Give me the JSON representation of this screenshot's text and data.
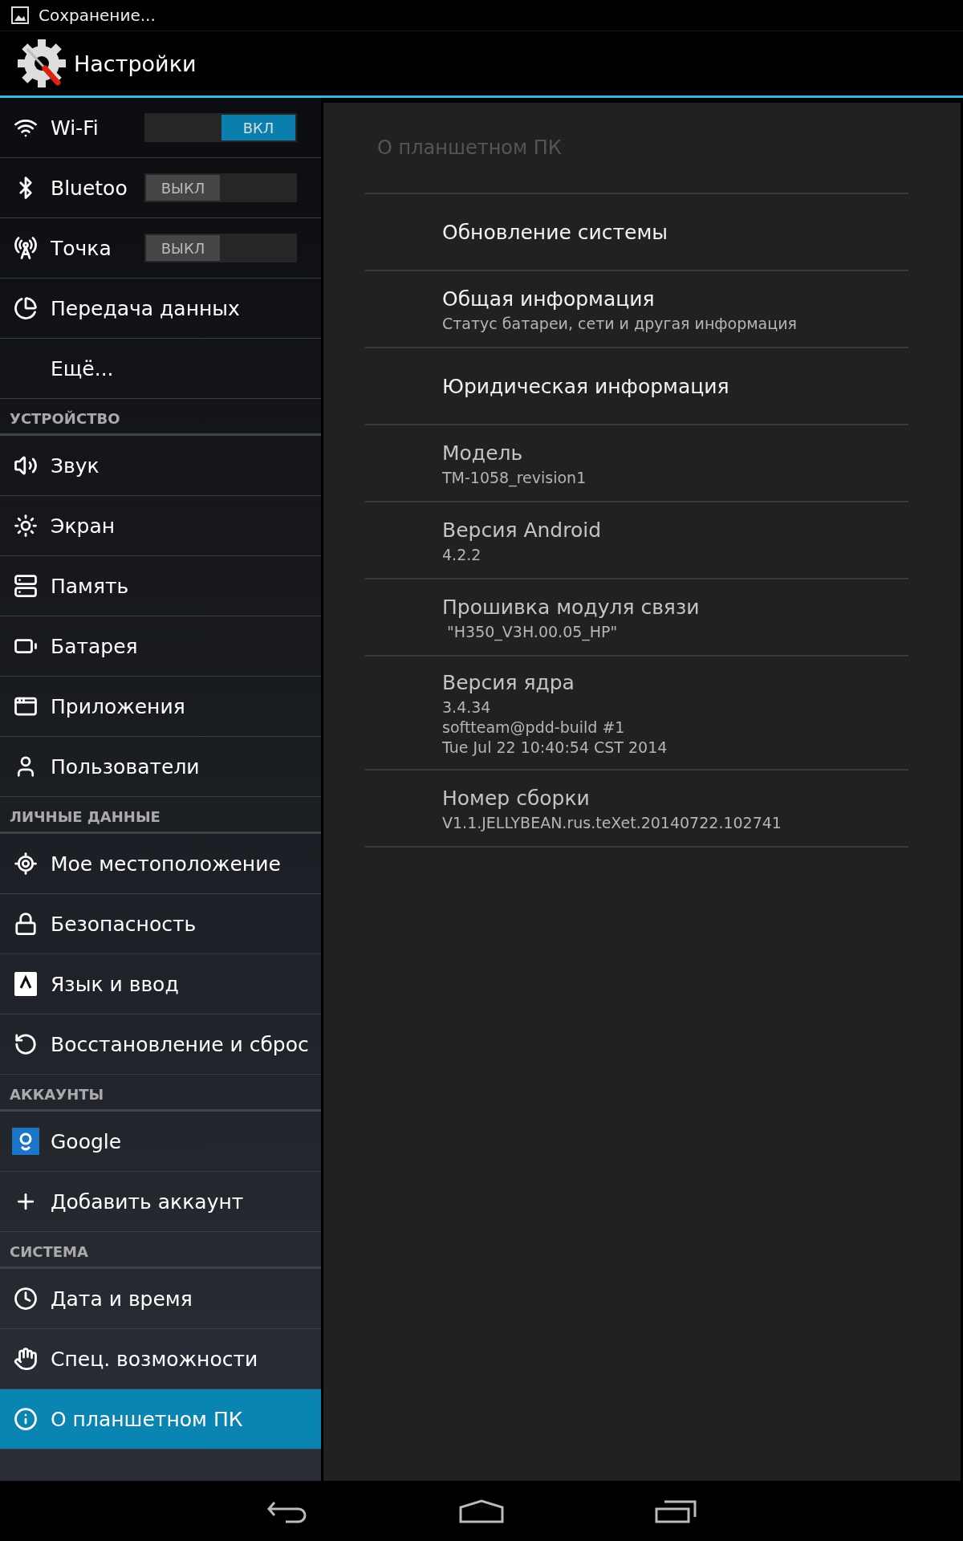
{
  "status_bar": {
    "notification": "Сохранение..."
  },
  "action_bar": {
    "title": "Настройки"
  },
  "sidebar": {
    "items": [
      {
        "kind": "switch",
        "label": "Wi-Fi",
        "on": true,
        "switch_label": "ВКЛ"
      },
      {
        "kind": "switch",
        "label": "Bluetoo",
        "on": false,
        "switch_label": "ВЫКЛ"
      },
      {
        "kind": "switch",
        "label": "Точка",
        "on": false,
        "switch_label": "ВЫКЛ"
      },
      {
        "kind": "item",
        "label": "Передача данных",
        "selected": false
      },
      {
        "kind": "item",
        "label": "Ещё...",
        "selected": false
      },
      {
        "kind": "header",
        "label": "УСТРОЙСТВО"
      },
      {
        "kind": "item",
        "label": "Звук",
        "selected": false
      },
      {
        "kind": "item",
        "label": "Экран",
        "selected": false
      },
      {
        "kind": "item",
        "label": "Память",
        "selected": false
      },
      {
        "kind": "item",
        "label": "Батарея",
        "selected": false
      },
      {
        "kind": "item",
        "label": "Приложения",
        "selected": false
      },
      {
        "kind": "item",
        "label": "Пользователи",
        "selected": false
      },
      {
        "kind": "header",
        "label": "ЛИЧНЫЕ ДАННЫЕ"
      },
      {
        "kind": "item",
        "label": "Мое местоположение",
        "selected": false
      },
      {
        "kind": "item",
        "label": "Безопасность",
        "selected": false
      },
      {
        "kind": "item",
        "label": "Язык и ввод",
        "selected": false
      },
      {
        "kind": "item",
        "label": "Восстановление и сброс",
        "selected": false
      },
      {
        "kind": "header",
        "label": "АККАУНТЫ"
      },
      {
        "kind": "item",
        "label": "Google",
        "selected": false
      },
      {
        "kind": "item",
        "label": "Добавить аккаунт",
        "selected": false
      },
      {
        "kind": "header",
        "label": "СИСТЕМА"
      },
      {
        "kind": "item",
        "label": "Дата и время",
        "selected": false
      },
      {
        "kind": "item",
        "label": "Спец. возможности",
        "selected": false
      },
      {
        "kind": "item",
        "label": "О планшетном ПК",
        "selected": true
      }
    ]
  },
  "detail": {
    "title": "О планшетном ПК",
    "items": [
      {
        "kind": "action",
        "title": "Обновление системы"
      },
      {
        "kind": "action",
        "title": "Общая информация",
        "summary": [
          "Статус батареи, сети и другая информация"
        ]
      },
      {
        "kind": "action",
        "title": "Юридическая информация"
      },
      {
        "kind": "info",
        "title": "Модель",
        "summary": [
          "TM-1058_revision1"
        ]
      },
      {
        "kind": "info",
        "title": "Версия Android",
        "summary": [
          "4.2.2"
        ]
      },
      {
        "kind": "info",
        "title": "Прошивка модуля связи",
        "summary": [
          " \"H350_V3H.00.05_HP\""
        ]
      },
      {
        "kind": "info",
        "title": "Версия ядра",
        "summary": [
          "3.4.34",
          "softteam@pdd-build #1",
          "Tue Jul 22 10:40:54 CST 2014"
        ]
      },
      {
        "kind": "info",
        "title": "Номер сборки",
        "summary": [
          "V1.1.JELLYBEAN.rus.teXet.20140722.102741"
        ]
      }
    ]
  }
}
